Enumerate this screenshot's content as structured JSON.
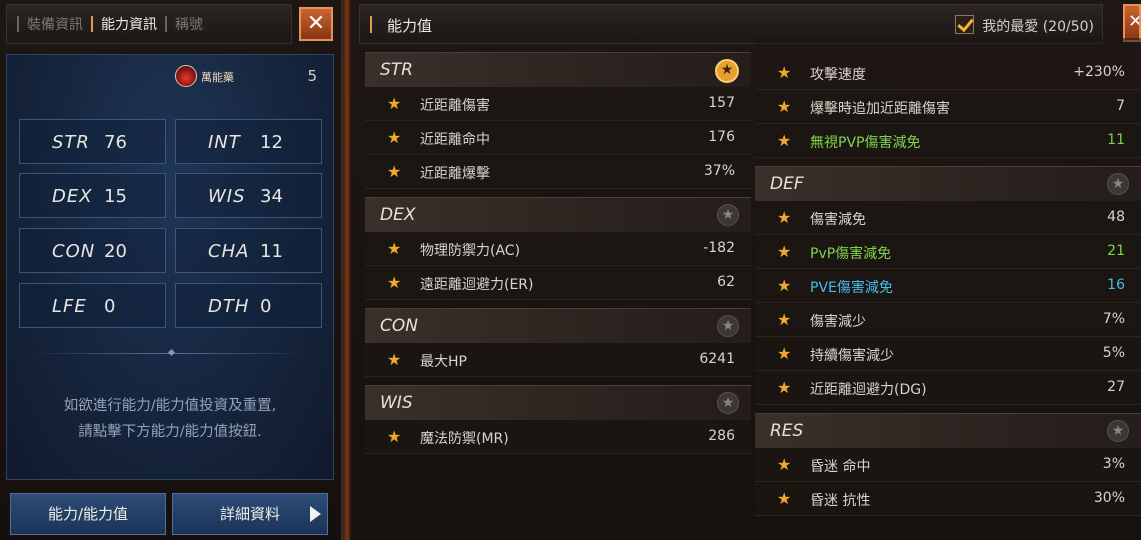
{
  "left": {
    "tabs": [
      "裝備資訊",
      "能力資訊",
      "稱號"
    ],
    "active_tab": 1,
    "close_label": "✕",
    "class_name": "萬能藥",
    "level": "5",
    "stats": [
      {
        "name": "STR",
        "value": "76"
      },
      {
        "name": "INT",
        "value": "12"
      },
      {
        "name": "DEX",
        "value": "15"
      },
      {
        "name": "WIS",
        "value": "34"
      },
      {
        "name": "CON",
        "value": "20"
      },
      {
        "name": "CHA",
        "value": "11"
      },
      {
        "name": "LFE",
        "value": "0"
      },
      {
        "name": "DTH",
        "value": "0"
      }
    ],
    "hint_line1": "如欲進行能力/能力值投資及重置,",
    "hint_line2": "請點擊下方能力/能力值按鈕.",
    "btn_stats": "能力/能力值",
    "btn_details": "詳細資料"
  },
  "right": {
    "title": "能力值",
    "fav_label": "我的最愛 (20/50)",
    "close_label": "✕",
    "col1": [
      {
        "name": "STR",
        "fav": true,
        "rows": [
          {
            "label": "近距離傷害",
            "value": "157",
            "color": "normal"
          },
          {
            "label": "近距離命中",
            "value": "176",
            "color": "normal"
          },
          {
            "label": "近距離爆擊",
            "value": "37%",
            "color": "normal"
          }
        ]
      },
      {
        "name": "DEX",
        "fav": false,
        "rows": [
          {
            "label": "物理防禦力(AC)",
            "value": "-182",
            "color": "normal"
          },
          {
            "label": "遠距離迴避力(ER)",
            "value": "62",
            "color": "normal"
          }
        ]
      },
      {
        "name": "CON",
        "fav": false,
        "rows": [
          {
            "label": "最大HP",
            "value": "6241",
            "color": "normal"
          }
        ]
      },
      {
        "name": "WIS",
        "fav": false,
        "rows": [
          {
            "label": "魔法防禦(MR)",
            "value": "286",
            "color": "normal"
          }
        ]
      }
    ],
    "col2_top_rows": [
      {
        "label": "攻擊速度",
        "value": "+230%",
        "color": "normal"
      },
      {
        "label": "爆擊時追加近距離傷害",
        "value": "7",
        "color": "normal"
      },
      {
        "label": "無視PVP傷害減免",
        "value": "11",
        "color": "green"
      }
    ],
    "col2": [
      {
        "name": "DEF",
        "fav": false,
        "rows": [
          {
            "label": "傷害減免",
            "value": "48",
            "color": "normal"
          },
          {
            "label": "PvP傷害減免",
            "value": "21",
            "color": "green"
          },
          {
            "label": "PVE傷害減免",
            "value": "16",
            "color": "blue"
          },
          {
            "label": "傷害減少",
            "value": "7%",
            "color": "normal"
          },
          {
            "label": "持續傷害減少",
            "value": "5%",
            "color": "normal"
          },
          {
            "label": "近距離迴避力(DG)",
            "value": "27",
            "color": "normal"
          }
        ]
      },
      {
        "name": "RES",
        "fav": false,
        "rows": [
          {
            "label": "昏迷 命中",
            "value": "3%",
            "color": "normal"
          },
          {
            "label": "昏迷 抗性",
            "value": "30%",
            "color": "normal"
          }
        ]
      }
    ],
    "star_glyph": "★"
  }
}
